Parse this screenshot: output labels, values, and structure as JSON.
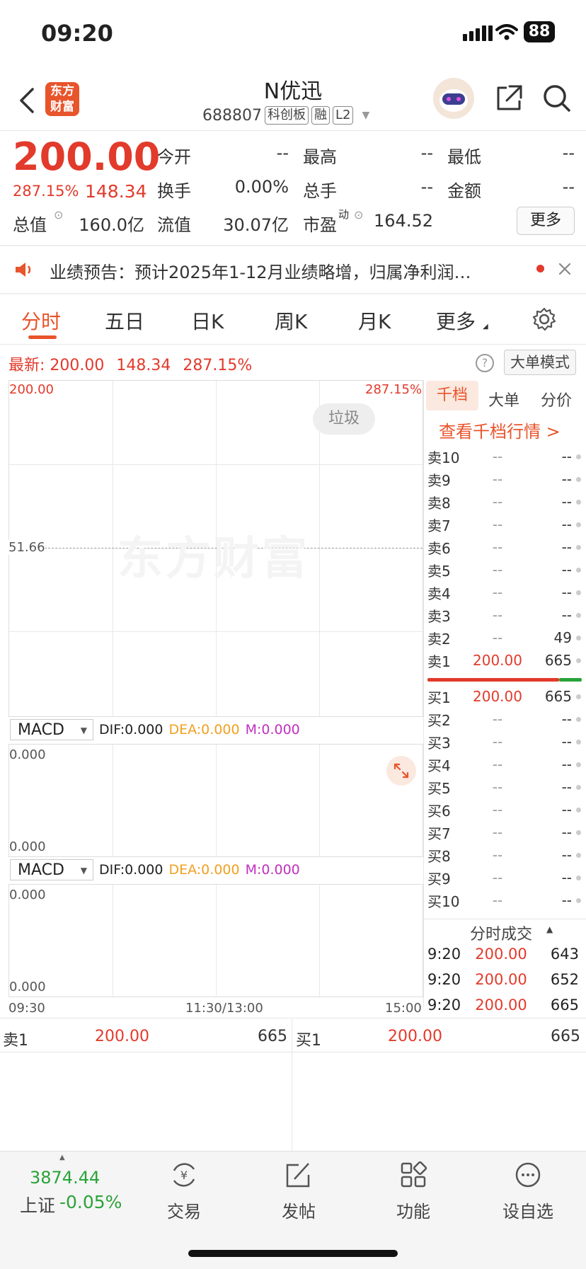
{
  "status_bar": {
    "time": "09:20",
    "battery": "88"
  },
  "header": {
    "title": "N优迅",
    "code": "688807",
    "tags": [
      "科创板",
      "融",
      "L2"
    ],
    "logo_text": "东方财富"
  },
  "quote": {
    "price": "200.00",
    "change_pct": "287.15%",
    "change": "148.34",
    "open_label": "今开",
    "open": "--",
    "high_label": "最高",
    "high": "--",
    "low_label": "最低",
    "low": "--",
    "turnover_label": "换手",
    "turnover": "0.00%",
    "volume_label": "总手",
    "volume": "--",
    "amount_label": "金额",
    "amount": "--",
    "mktcap_label": "总值",
    "mktcap": "160.0亿",
    "float_label": "流值",
    "float": "30.07亿",
    "pe_label": "市盈",
    "pe_sup": "动",
    "pe": "164.52",
    "more_label": "更多"
  },
  "notice": {
    "text": "业绩预告：预计2025年1-12月业绩略增，归属净利润…"
  },
  "tabs": [
    "分时",
    "五日",
    "日K",
    "周K",
    "月K",
    "更多"
  ],
  "latest_line": {
    "label": "最新:",
    "price": "200.00",
    "change": "148.34",
    "pct": "287.15%"
  },
  "mode_button": "大单模式",
  "chart": {
    "top_left": "200.00",
    "top_right": "287.15%",
    "mid_label": "51.66",
    "tag": "垃圾",
    "watermark": "东方财富",
    "x_labels": [
      "09:30",
      "11:30/13:00",
      "15:00"
    ]
  },
  "macd_panels": [
    {
      "selector": "MACD",
      "dif": "DIF:0.000",
      "dea": "DEA:0.000",
      "m": "M:0.000",
      "top": "0.000",
      "bottom": "0.000"
    },
    {
      "selector": "MACD",
      "dif": "DIF:0.000",
      "dea": "DEA:0.000",
      "m": "M:0.000",
      "top": "0.000",
      "bottom": "0.000"
    }
  ],
  "orderbook": {
    "tabs": [
      "千档",
      "大单",
      "分价"
    ],
    "link": "查看千档行情 >",
    "asks": [
      {
        "label": "卖10",
        "price": "--",
        "vol": "--"
      },
      {
        "label": "卖9",
        "price": "--",
        "vol": "--"
      },
      {
        "label": "卖8",
        "price": "--",
        "vol": "--"
      },
      {
        "label": "卖7",
        "price": "--",
        "vol": "--"
      },
      {
        "label": "卖6",
        "price": "--",
        "vol": "--"
      },
      {
        "label": "卖5",
        "price": "--",
        "vol": "--"
      },
      {
        "label": "卖4",
        "price": "--",
        "vol": "--"
      },
      {
        "label": "卖3",
        "price": "--",
        "vol": "--"
      },
      {
        "label": "卖2",
        "price": "--",
        "vol": "49"
      },
      {
        "label": "卖1",
        "price": "200.00",
        "vol": "665"
      }
    ],
    "bids": [
      {
        "label": "买1",
        "price": "200.00",
        "vol": "665"
      },
      {
        "label": "买2",
        "price": "--",
        "vol": "--"
      },
      {
        "label": "买3",
        "price": "--",
        "vol": "--"
      },
      {
        "label": "买4",
        "price": "--",
        "vol": "--"
      },
      {
        "label": "买5",
        "price": "--",
        "vol": "--"
      },
      {
        "label": "买6",
        "price": "--",
        "vol": "--"
      },
      {
        "label": "买7",
        "price": "--",
        "vol": "--"
      },
      {
        "label": "买8",
        "price": "--",
        "vol": "--"
      },
      {
        "label": "买9",
        "price": "--",
        "vol": "--"
      },
      {
        "label": "买10",
        "price": "--",
        "vol": "--"
      }
    ],
    "trades_title": "分时成交",
    "trades": [
      {
        "time": "9:20",
        "price": "200.00",
        "vol": "643"
      },
      {
        "time": "9:20",
        "price": "200.00",
        "vol": "652"
      },
      {
        "time": "9:20",
        "price": "200.00",
        "vol": "665"
      }
    ]
  },
  "best_bar": {
    "ask_label": "卖1",
    "ask_price": "200.00",
    "ask_vol": "665",
    "bid_label": "买1",
    "bid_price": "200.00",
    "bid_vol": "665"
  },
  "bottom_nav": {
    "index_value": "3874.44",
    "index_name": "上证",
    "index_change": "-0.05%",
    "items": [
      "交易",
      "发帖",
      "功能",
      "设自选"
    ]
  }
}
